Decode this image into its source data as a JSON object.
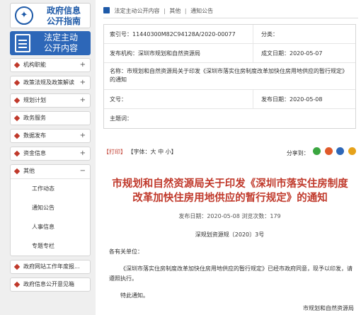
{
  "sidebar": {
    "guide": {
      "title_line1": "政府信息",
      "title_line2": "公开指南",
      "icon": "compass-icon"
    },
    "active": {
      "title_line1": "法定主动",
      "title_line2": "公开内容",
      "icon": "document-icon"
    },
    "items": [
      {
        "label": "机构职能",
        "sign": "+"
      },
      {
        "label": "政策法规及政策解读",
        "sign": "+"
      },
      {
        "label": "规划计划",
        "sign": "+"
      },
      {
        "label": "政务服务",
        "sign": ""
      },
      {
        "label": "数据发布",
        "sign": "+"
      },
      {
        "label": "资金信息",
        "sign": "+"
      }
    ],
    "expanded": {
      "label": "其他",
      "sign": "−",
      "children": [
        "工作动态",
        "通知公告",
        "人事信息",
        "专题专栏"
      ]
    },
    "bottom_items": [
      {
        "label": "政府网站工作年度报..."
      },
      {
        "label": "政府信息公开意见箱"
      }
    ],
    "accent_color": "#2d67b8",
    "dot_color": "#c0392b"
  },
  "breadcrumb": {
    "items": [
      "法定主动公开内容",
      "其他",
      "通知公告"
    ],
    "separator": "|"
  },
  "meta": {
    "index_label": "索引号：11440300M82C94128A/2020-00077",
    "category_label": "分类：",
    "issuer_label": "发布机构：深圳市规划和自然资源局",
    "created_label": "成文日期：2020-05-07",
    "name_label": "名称：市规划和自然资源局关于印发《深圳市落实住房制度改革加快住房用地供应的暂行规定》的通知",
    "docno_label": "文号：",
    "published_label": "发布日期：2020-05-08",
    "subject_label": "主题词："
  },
  "tools": {
    "print": "【打印】",
    "font": "【字体：大  中  小】",
    "share": "分享到："
  },
  "document": {
    "title": "市规划和自然资源局关于印发《深圳市落实住房制度改革加快住房用地供应的暂行规定》的通知",
    "info": "发布日期：2020-05-08  浏览次数：179",
    "number": "深规划资源规〔2020〕3号",
    "salutation": "各有关单位：",
    "paragraph1": "《深圳市落实住房制度改革加快住房用地供应的暂行规定》已经市政府同意，现予以印发，请遵照执行。",
    "paragraph2": "特此通知。",
    "signature": "市规划和自然资源局"
  },
  "share_colors": [
    "#3aa640",
    "#e05a2a",
    "#2d67b8",
    "#e6a21a"
  ]
}
